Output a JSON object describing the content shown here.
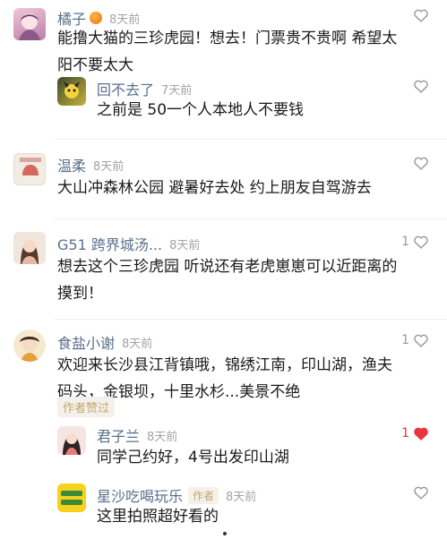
{
  "comments": [
    {
      "name": "橘子",
      "time": "8天前",
      "text_line1": "能撸大猫的三珍虎园！想去！门票贵不贵啊 希望太",
      "text_line2": "阳不要太大"
    },
    {
      "name": "温柔",
      "time": "8天前",
      "text": "大山冲森林公园 避暑好去处 约上朋友自驾游去"
    },
    {
      "name": "G51 跨界城汤...",
      "time": "8天前",
      "likes": "1",
      "text_line1": "想去这个三珍虎园 听说还有老虎崽崽可以近距离的",
      "text_line2": "摸到！"
    },
    {
      "name": "食盐小谢",
      "time": "8天前",
      "likes": "1",
      "text_line1": "欢迎来长沙县江背镇哦，锦绣江南，印山湖，渔夫",
      "text_line2": "码头，金银坝，十里水杉...美景不绝",
      "badge": "作者赞过"
    }
  ],
  "replies": [
    {
      "name": "回不去了",
      "time": "7天前",
      "text": "之前是 50一个人本地人不要钱"
    },
    {
      "name": "君子兰",
      "time": "8天前",
      "likes": "1",
      "text": "同学己约好，4号出发印山湖"
    },
    {
      "name": "星沙吃喝玩乐",
      "tag": "作者",
      "time": "8天前",
      "text": "这里拍照超好看的"
    }
  ],
  "colors": {
    "name": "#5b6f8c",
    "liked_heart": "#e8343b",
    "author_tag_bg": "#f4f1ec",
    "author_tag_text": "#c4a66a"
  }
}
